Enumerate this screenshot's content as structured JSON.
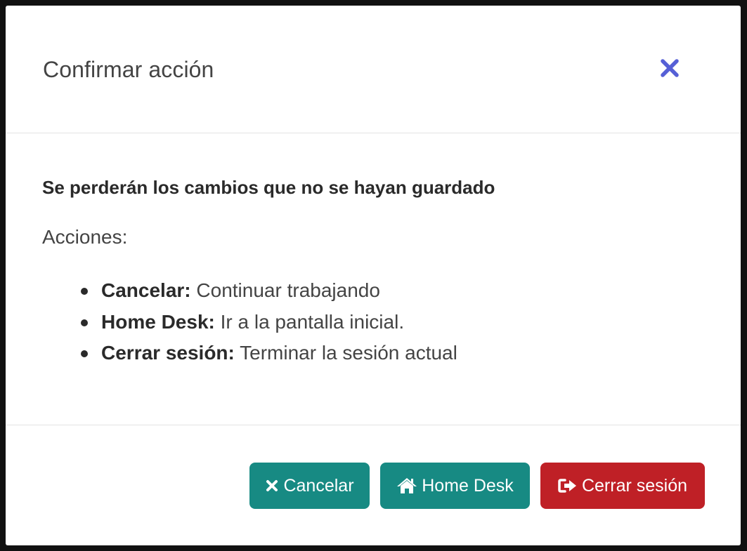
{
  "modal": {
    "title": "Confirmar acción",
    "close_icon": "close-x-icon",
    "close_color": "#5660d6"
  },
  "body": {
    "warning": "Se perderán los cambios que no se hayan guardado",
    "actions_heading": "Acciones:",
    "actions": [
      {
        "label": "Cancelar:",
        "description": "Continuar trabajando"
      },
      {
        "label": "Home Desk:",
        "description": "Ir a la pantalla inicial."
      },
      {
        "label": "Cerrar sesión:",
        "description": "Terminar la sesión actual"
      }
    ]
  },
  "footer": {
    "cancel": {
      "label": "Cancelar",
      "icon": "times-icon",
      "color": "#178a83"
    },
    "home": {
      "label": "Home Desk",
      "icon": "home-icon",
      "color": "#178a83"
    },
    "logout": {
      "label": "Cerrar sesión",
      "icon": "sign-out-icon",
      "color": "#bf2026"
    }
  }
}
